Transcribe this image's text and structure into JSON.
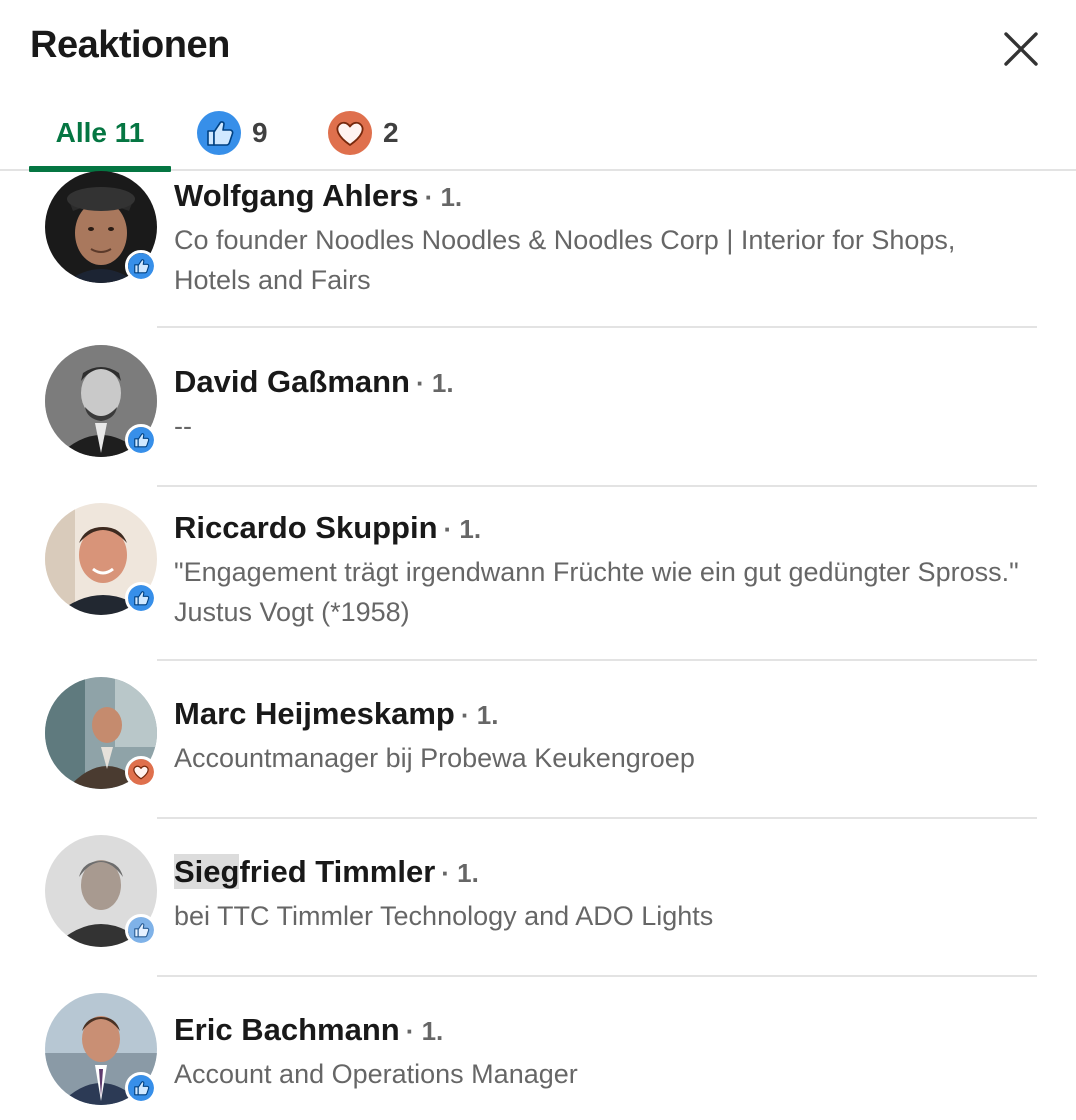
{
  "modal": {
    "title": "Reaktionen"
  },
  "tabs": [
    {
      "label": "Alle 11",
      "active": true
    },
    {
      "icon": "like-icon",
      "count": "9"
    },
    {
      "icon": "love-icon",
      "count": "2"
    }
  ],
  "colors": {
    "accent": "#057642",
    "like": "#378fe9",
    "love": "#df704d"
  },
  "reactors": [
    {
      "name": "Wolfgang Ahlers",
      "degree": "· 1.",
      "headline": "Co founder Noodles Noodles & Noodles Corp | Interior for Shops, Hotels and Fairs",
      "reaction": "like"
    },
    {
      "name": "David Gaßmann",
      "degree": "· 1.",
      "headline": "--",
      "reaction": "like"
    },
    {
      "name": "Riccardo Skuppin",
      "degree": "· 1.",
      "headline": "\"Engagement trägt irgendwann Früchte wie ein gut gedüngter Spross.\" Justus Vogt (*1958)",
      "reaction": "like"
    },
    {
      "name": "Marc Heijmeskamp",
      "degree": "· 1.",
      "headline": "Accountmanager bij Probewa Keukengroep",
      "reaction": "love"
    },
    {
      "name_highlight": "Sieg",
      "name_rest": "fried Timmler",
      "degree": "· 1.",
      "headline": "bei TTC Timmler Technology and ADO Lights",
      "reaction": "like"
    },
    {
      "name": "Eric Bachmann",
      "degree": "· 1.",
      "headline": "Account and Operations Manager",
      "reaction": "like"
    }
  ]
}
